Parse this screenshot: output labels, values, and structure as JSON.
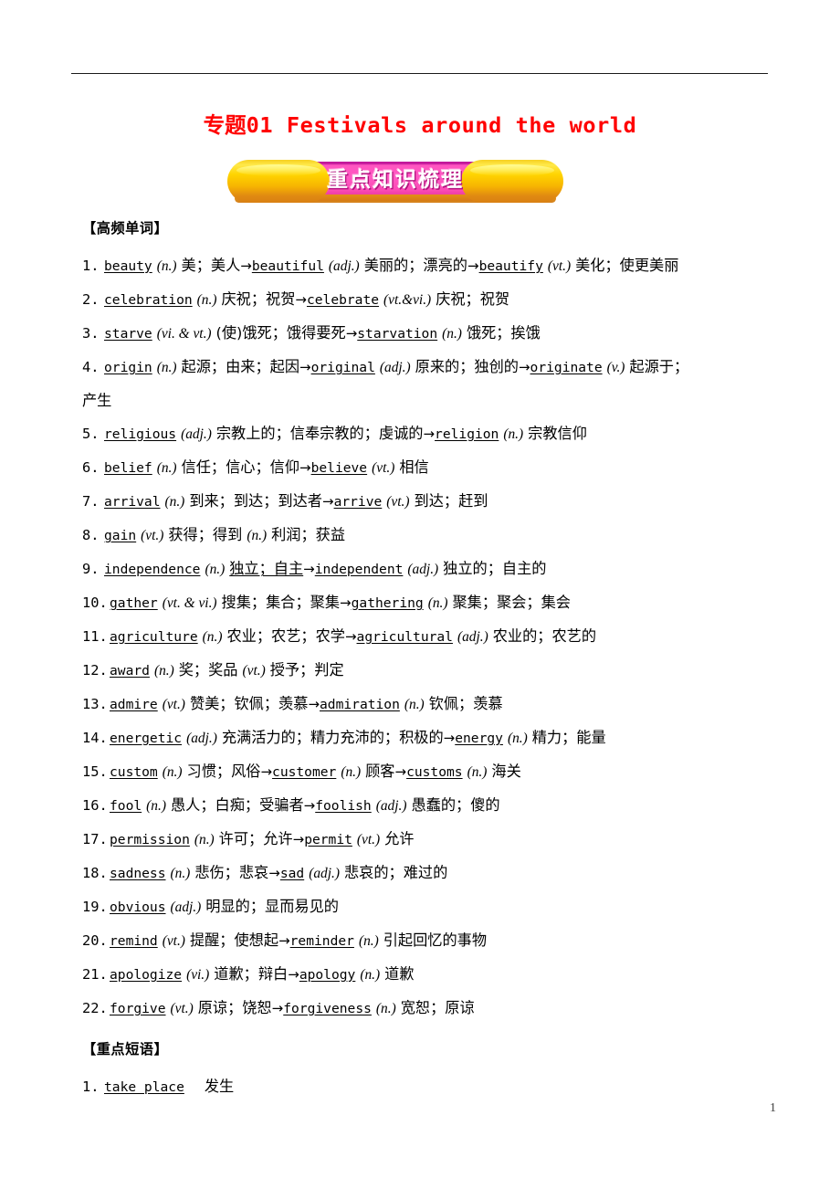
{
  "document": {
    "title_cjk": "专题",
    "title_rest": "01 Festivals around the world",
    "title_full": "专题01 Festivals around the world",
    "page_number": "1",
    "title_color": "#ff0000"
  },
  "banner": {
    "label": "重点知识梳理",
    "core_color": "#ff58c2",
    "cap_color": "#ffd400",
    "text_color": "#ffffff"
  },
  "sections": [
    {
      "heading": "【高频单词】",
      "type": "words",
      "items": [
        {
          "num": "1.",
          "word": "beauty",
          "pos": "(n.)",
          "def": "美；美人",
          "derivatives": [
            {
              "word": "beautiful",
              "pos": "(adj.)",
              "def": "美丽的；漂亮的"
            },
            {
              "word": "beautify",
              "pos": "(vt.)",
              "def": "美化；使更美丽"
            }
          ]
        },
        {
          "num": "2.",
          "word": "celebration",
          "pos": "(n.)",
          "def": "庆祝；祝贺",
          "derivatives": [
            {
              "word": "celebrate",
              "pos": "(vt.&vi.)",
              "def": "庆祝；祝贺"
            }
          ]
        },
        {
          "num": "3.",
          "word": "starve",
          "pos": "(vi. & vt.)",
          "def": "(使)饿死；饿得要死",
          "derivatives": [
            {
              "word": "starvation",
              "pos": "(n.)",
              "def": "饿死；挨饿"
            }
          ]
        },
        {
          "num": "4.",
          "word": "origin",
          "pos": "(n.)",
          "def": "起源；由来；起因",
          "derivatives": [
            {
              "word": "original",
              "pos": "(adj.)",
              "def": "原来的；独创的"
            },
            {
              "word": "originate",
              "pos": "(v.)",
              "def": "起源于；产生"
            }
          ],
          "wrap_tail": "产生",
          "def_tail_inline": "起源于；"
        },
        {
          "num": "5.",
          "word": "religious",
          "pos": "(adj.)",
          "def": "宗教上的；信奉宗教的；虔诚的",
          "derivatives": [
            {
              "word": "religion",
              "pos": "(n.)",
              "def": "宗教信仰"
            }
          ]
        },
        {
          "num": "6.",
          "word": "belief",
          "pos": "(n.)",
          "def": "信任；信心；信仰",
          "derivatives": [
            {
              "word": "believe",
              "pos": "(vt.)",
              "def": "相信"
            }
          ]
        },
        {
          "num": "7.",
          "word": "arrival",
          "pos": "(n.)",
          "def": "到来；到达；到达者",
          "derivatives": [
            {
              "word": "arrive",
              "pos": "(vt.)",
              "def": "到达；赶到"
            }
          ]
        },
        {
          "num": "8.",
          "word": "gain",
          "pos": "(vt.)",
          "def": "获得；得到",
          "pos2": "(n.)",
          "def2": "利润；获益",
          "derivatives": []
        },
        {
          "num": "9.",
          "word": "independence",
          "pos": "(n.)",
          "def": "独立；自主",
          "def_underlined": true,
          "derivatives": [
            {
              "word": "independent",
              "pos": "(adj.)",
              "def": "独立的；自主的"
            }
          ]
        },
        {
          "num": "10.",
          "word": "gather",
          "pos": "(vt. & vi.)",
          "def": "搜集；集合；聚集",
          "derivatives": [
            {
              "word": "gathering",
              "pos": "(n.)",
              "def": "聚集；聚会；集会"
            }
          ]
        },
        {
          "num": "11.",
          "word": "agriculture",
          "pos": "(n.)",
          "def": "农业；农艺；农学",
          "derivatives": [
            {
              "word": "agricultural",
              "pos": "(adj.)",
              "def": "农业的；农艺的"
            }
          ]
        },
        {
          "num": "12.",
          "word": "award",
          "pos": "(n.)",
          "def": "奖；奖品",
          "pos2": "(vt.)",
          "def2": "授予；判定",
          "derivatives": []
        },
        {
          "num": "13.",
          "word": "admire",
          "pos": "(vt.)",
          "def": "赞美；钦佩；羡慕",
          "derivatives": [
            {
              "word": "admiration",
              "pos": "(n.)",
              "def": "钦佩；羡慕"
            }
          ]
        },
        {
          "num": "14.",
          "word": "energetic",
          "pos": "(adj.)",
          "def": "充满活力的；精力充沛的；积极的",
          "derivatives": [
            {
              "word": "energy",
              "pos": "(n.)",
              "def": "精力；能量"
            }
          ]
        },
        {
          "num": "15.",
          "word": "custom",
          "pos": "(n.)",
          "def": "习惯；风俗",
          "derivatives": [
            {
              "word": "customer",
              "pos": "(n.)",
              "def": "顾客"
            },
            {
              "word": "customs",
              "pos": "(n.)",
              "def": "海关"
            }
          ]
        },
        {
          "num": "16.",
          "word": "fool",
          "pos": "(n.)",
          "def": "愚人；白痴；受骗者",
          "derivatives": [
            {
              "word": "foolish",
              "pos": "(adj.)",
              "def": "愚蠢的；傻的"
            }
          ]
        },
        {
          "num": "17.",
          "word": "permission",
          "pos": "(n.)",
          "def": "许可；允许",
          "derivatives": [
            {
              "word": "permit",
              "pos": "(vt.)",
              "def": "允许"
            }
          ]
        },
        {
          "num": "18.",
          "word": "sadness",
          "pos": "(n.)",
          "def": "悲伤；悲哀",
          "derivatives": [
            {
              "word": "sad",
              "pos": "(adj.)",
              "def": "悲哀的；难过的"
            }
          ]
        },
        {
          "num": "19.",
          "word": "obvious",
          "pos": "(adj.)",
          "def": "明显的；显而易见的",
          "derivatives": []
        },
        {
          "num": "20.",
          "word": "remind",
          "pos": "(vt.)",
          "def": "提醒；使想起",
          "derivatives": [
            {
              "word": "reminder",
              "pos": "(n.)",
              "def": "引起回忆的事物"
            }
          ]
        },
        {
          "num": "21.",
          "word": "apologize",
          "pos": "(vi.)",
          "def": "道歉；辩白",
          "derivatives": [
            {
              "word": "apology",
              "pos": "(n.)",
              "def": "道歉"
            }
          ]
        },
        {
          "num": "22.",
          "word": "forgive",
          "pos": "(vt.)",
          "def": "原谅；饶恕",
          "derivatives": [
            {
              "word": "forgiveness",
              "pos": "(n.)",
              "def": "宽恕；原谅"
            }
          ]
        }
      ]
    },
    {
      "heading": "【重点短语】",
      "type": "phrases",
      "items": [
        {
          "num": "1.",
          "phrase": "take place",
          "def": "发生"
        }
      ]
    }
  ]
}
